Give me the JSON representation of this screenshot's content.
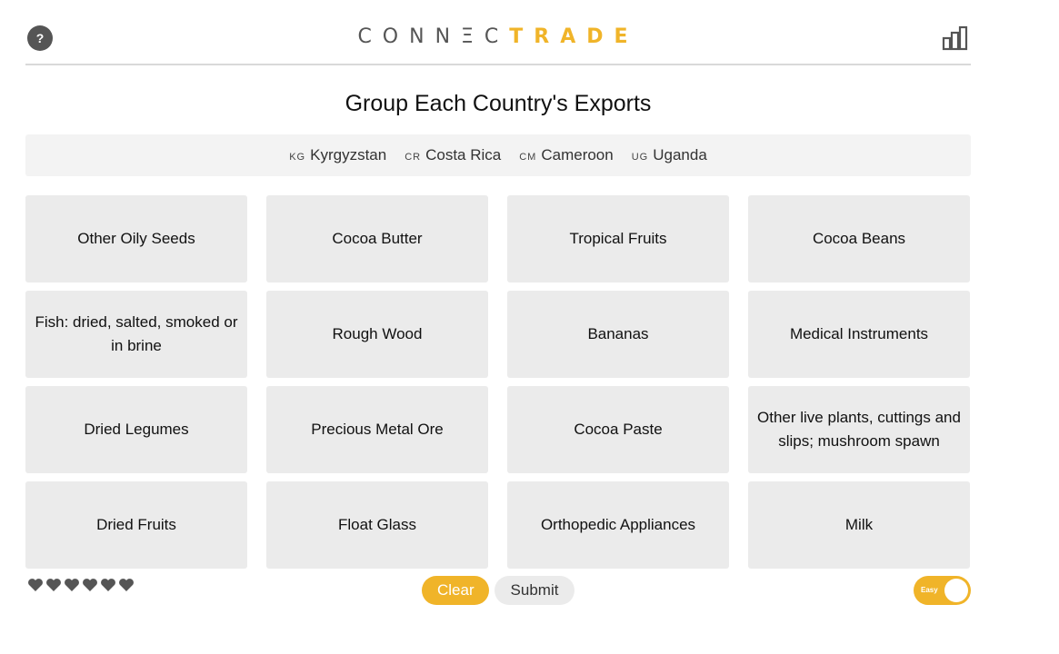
{
  "header": {
    "help_label": "?",
    "logo_part1": "CONNΞC",
    "logo_part2": "TRADE"
  },
  "title": "Group Each Country's Exports",
  "countries": [
    {
      "code": "KG",
      "name": "Kyrgyzstan"
    },
    {
      "code": "CR",
      "name": "Costa Rica"
    },
    {
      "code": "CM",
      "name": "Cameroon"
    },
    {
      "code": "UG",
      "name": "Uganda"
    }
  ],
  "tiles": [
    "Other Oily Seeds",
    "Cocoa Butter",
    "Tropical Fruits",
    "Cocoa Beans",
    "Fish: dried, salted, smoked or in brine",
    "Rough Wood",
    "Bananas",
    "Medical Instruments",
    "Dried Legumes",
    "Precious Metal Ore",
    "Cocoa Paste",
    "Other live plants, cuttings and slips; mushroom spawn",
    "Dried Fruits",
    "Float Glass",
    "Orthopedic Appliances",
    "Milk"
  ],
  "lives_remaining": 6,
  "buttons": {
    "clear": "Clear",
    "submit": "Submit"
  },
  "difficulty_toggle": {
    "label": "Easy",
    "on": true
  },
  "colors": {
    "accent": "#f0b429",
    "tile_bg": "#ebebeb",
    "icon_dark": "#555555"
  }
}
